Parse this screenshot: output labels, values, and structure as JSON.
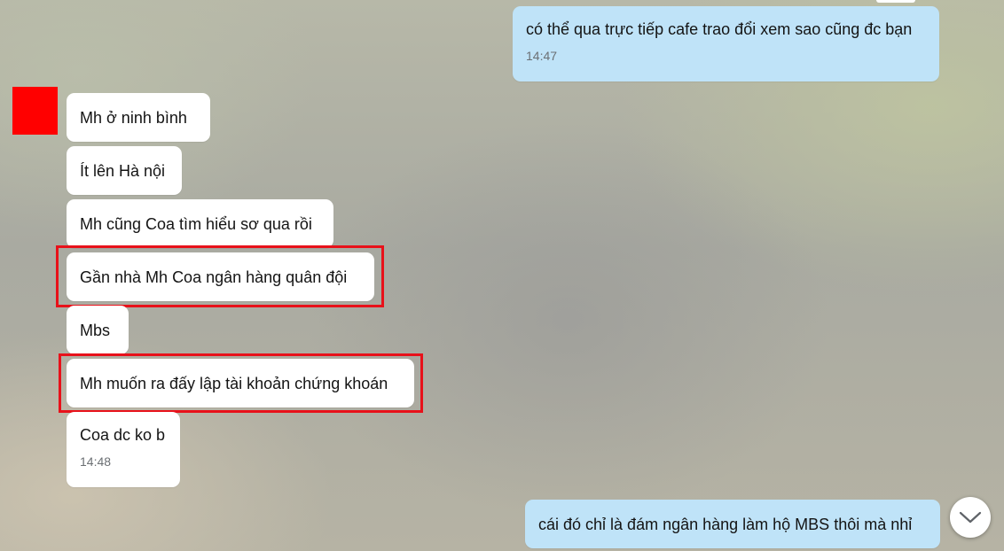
{
  "messages": {
    "outgoing_1": {
      "text": "có thể qua trực tiếp cafe trao đổi xem sao cũng đc bạn",
      "time": "14:47"
    },
    "incoming": [
      {
        "text": "Mh ở ninh bình"
      },
      {
        "text": "Ít lên Hà nội"
      },
      {
        "text": "Mh cũng Coa tìm hiểu sơ qua rồi"
      },
      {
        "text": "Gần nhà Mh Coa ngân hàng quân đội"
      },
      {
        "text": "Mbs"
      },
      {
        "text": "Mh muốn ra đấy lập tài khoản chứng khoán"
      },
      {
        "text": "Coa dc ko b",
        "time": "14:48"
      }
    ],
    "outgoing_2": {
      "text": "cái đó chỉ là đám ngân hàng làm hộ MBS thôi mà nhỉ"
    }
  },
  "colors": {
    "outgoing_bubble": "#bfe3f8",
    "incoming_bubble": "#ffffff",
    "highlight_border": "#e8111a",
    "avatar": "#ff0000"
  },
  "icons": {
    "scroll_down": "chevron-down-icon"
  }
}
